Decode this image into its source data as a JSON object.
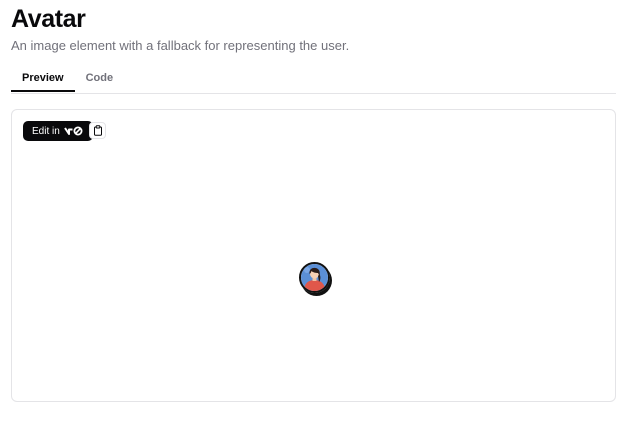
{
  "header": {
    "title": "Avatar",
    "description": "An image element with a fallback for representing the user."
  },
  "tabs": [
    {
      "label": "Preview",
      "active": true
    },
    {
      "label": "Code",
      "active": false
    }
  ],
  "preview": {
    "edit_button_label": "Edit in",
    "edit_button_icon": "v0-logo-icon",
    "copy_button_icon": "clipboard-icon",
    "avatar_icon": "user-avatar-illustration"
  },
  "colors": {
    "primary": "#09090b",
    "muted_text": "#71717a",
    "border": "#e4e4e7"
  }
}
